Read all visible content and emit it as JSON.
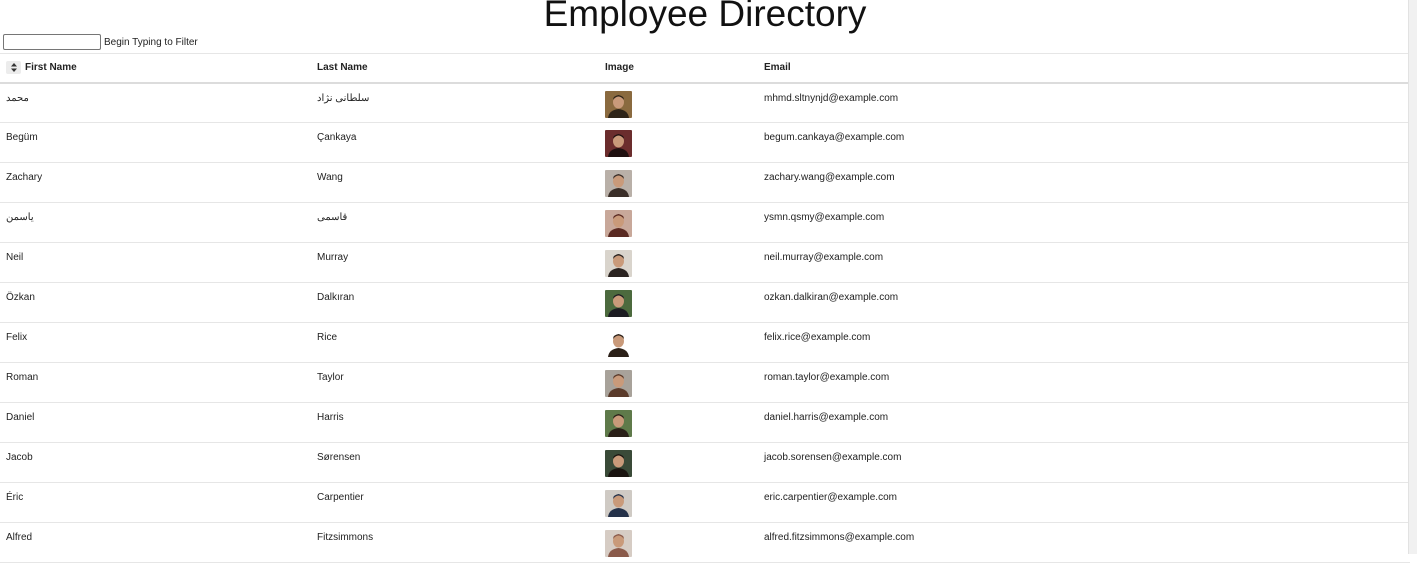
{
  "page": {
    "title": "Employee Directory"
  },
  "filter": {
    "value": "",
    "placeholder": "",
    "label": "Begin Typing to Filter"
  },
  "table": {
    "headers": {
      "first_name": "First Name",
      "last_name": "Last Name",
      "image": "Image",
      "email": "Email"
    },
    "sort_icon": "sort-updown-icon",
    "rows": [
      {
        "first": "محمد",
        "last": "سلطانی نژاد",
        "email": "mhmd.sltnynjd@example.com",
        "avatar_bg": "#8a6a3f",
        "avatar_fg": "#2e2418"
      },
      {
        "first": "Begüm",
        "last": "Çankaya",
        "email": "begum.cankaya@example.com",
        "avatar_bg": "#6b2d2d",
        "avatar_fg": "#1f1010"
      },
      {
        "first": "Zachary",
        "last": "Wang",
        "email": "zachary.wang@example.com",
        "avatar_bg": "#b9b0a8",
        "avatar_fg": "#3a2e28"
      },
      {
        "first": "یاسمن",
        "last": "قاسمی",
        "email": "ysmn.qsmy@example.com",
        "avatar_bg": "#c8a89a",
        "avatar_fg": "#5a2a22"
      },
      {
        "first": "Neil",
        "last": "Murray",
        "email": "neil.murray@example.com",
        "avatar_bg": "#d9d4cc",
        "avatar_fg": "#2a2320"
      },
      {
        "first": "Özkan",
        "last": "Dalkıran",
        "email": "ozkan.dalkiran@example.com",
        "avatar_bg": "#4c6a3e",
        "avatar_fg": "#1c1c22"
      },
      {
        "first": "Felix",
        "last": "Rice",
        "email": "felix.rice@example.com",
        "avatar_bg": "#ffffff",
        "avatar_fg": "#2b2018"
      },
      {
        "first": "Roman",
        "last": "Taylor",
        "email": "roman.taylor@example.com",
        "avatar_bg": "#a8a29a",
        "avatar_fg": "#5a3a2a"
      },
      {
        "first": "Daniel",
        "last": "Harris",
        "email": "daniel.harris@example.com",
        "avatar_bg": "#5f7a4a",
        "avatar_fg": "#2a2018"
      },
      {
        "first": "Jacob",
        "last": "Sørensen",
        "email": "jacob.sorensen@example.com",
        "avatar_bg": "#3a4a38",
        "avatar_fg": "#1a1410"
      },
      {
        "first": "Éric",
        "last": "Carpentier",
        "email": "eric.carpentier@example.com",
        "avatar_bg": "#cfcac4",
        "avatar_fg": "#25324a"
      },
      {
        "first": "Alfred",
        "last": "Fitzsimmons",
        "email": "alfred.fitzsimmons@example.com",
        "avatar_bg": "#d6ccc4",
        "avatar_fg": "#8a5a4a"
      }
    ]
  }
}
